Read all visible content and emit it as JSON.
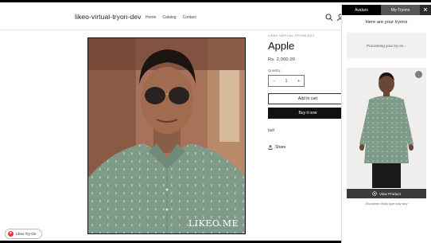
{
  "store": {
    "brand": "likeo-virtual-tryon-dev",
    "nav": [
      "Home",
      "Catalog",
      "Contact"
    ],
    "icons": [
      "search-icon",
      "account-icon"
    ]
  },
  "product": {
    "vendor": "LIKEO-VIRTUAL-TRYON-DEV",
    "title": "Apple",
    "price": "Rs. 2,000.00",
    "quantity_label": "Quantity",
    "quantity_value": "1",
    "minus": "−",
    "plus": "+",
    "add_to_cart": "Add to cart",
    "buy_now": "Buy it now",
    "description": "ball",
    "share": "Share",
    "watermark": "LIKEO.ME"
  },
  "tryon_launcher": {
    "label": "Likeo Try-On"
  },
  "panel": {
    "tabs": [
      "Avatars",
      "My-Tryons"
    ],
    "close": "✕",
    "heading": "Here are your tryons",
    "processing": "Processing your try-on...",
    "view_product": "View Product",
    "disclaimer": "Disclaimer: Body type may vary"
  },
  "colors": {
    "shirt": "#7f9a88",
    "panel_tab_bg": "#2b2b2b",
    "buy_button": "#111111",
    "heart": "#e03a3a"
  }
}
